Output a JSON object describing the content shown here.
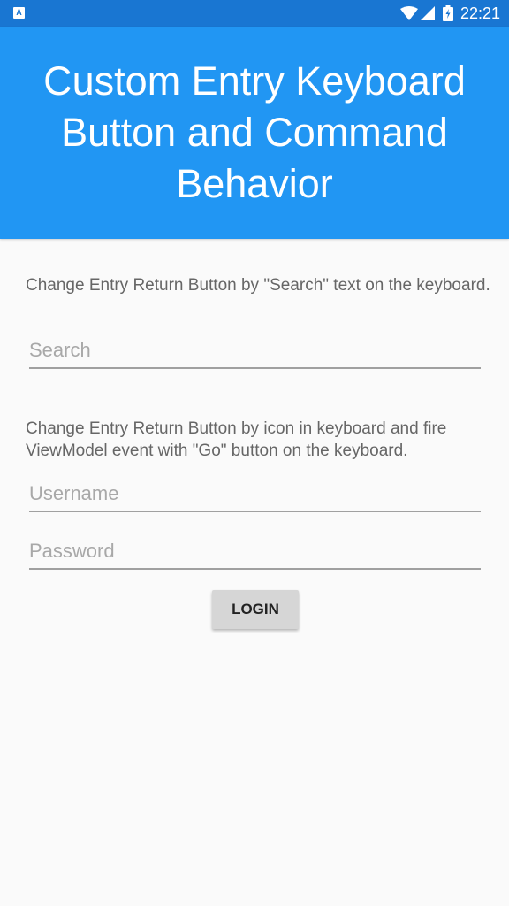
{
  "status_bar": {
    "app_icon": "A",
    "time": "22:21",
    "icons": [
      "app-notification-icon",
      "wifi-icon",
      "signal-icon",
      "battery-icon"
    ]
  },
  "header": {
    "title": "Custom Entry Keyboard Button and Command Behavior",
    "background_color": "#2196f3"
  },
  "search_section": {
    "description": "Change Entry Return Button by \"Search\" text on the keyboard.",
    "search_placeholder": "Search"
  },
  "login_section": {
    "description": "Change Entry Return Button by icon in keyboard and fire ViewModel event with \"Go\" button on the keyboard.",
    "username_placeholder": "Username",
    "password_placeholder": "Password",
    "login_label": "LOGIN"
  },
  "colors": {
    "status_bar": "#1976d2",
    "accent": "#2196f3",
    "background": "#fafafa"
  }
}
